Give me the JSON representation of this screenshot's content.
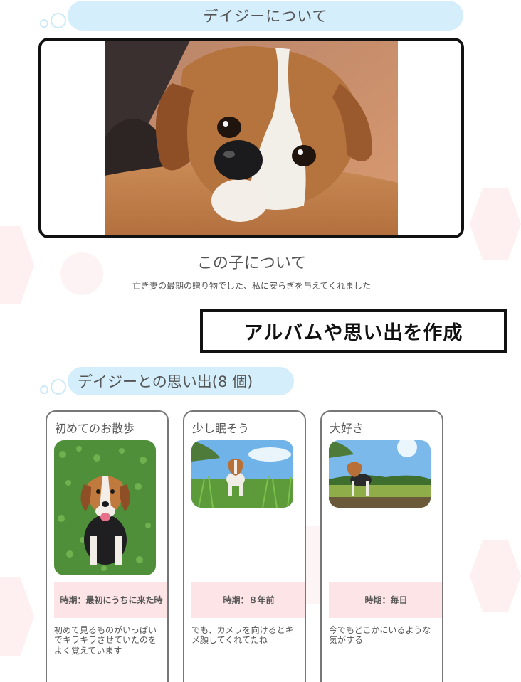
{
  "about_section": {
    "heading": "デイジーについて",
    "subtitle": "この子について",
    "description": "亡き妻の最期の贈り物でした、私に安らぎを与えてくれました"
  },
  "create_button": {
    "label": "アルバムや思い出を作成"
  },
  "memories_section": {
    "heading": "デイジーとの思い出(8 個)"
  },
  "memory_cards": [
    {
      "title": "初めてのお散歩",
      "period": "時期：最初にうちに来た時",
      "description": "初めて見るものがいっぱいでキラキラさせていたのをよく覚えています"
    },
    {
      "title": "少し眠そう",
      "period": "時期：８年前",
      "description": "でも、カメラを向けるとキメ顔してくれてたね"
    },
    {
      "title": "大好き",
      "period": "時期：毎日",
      "description": "今でもどこかにいるような気がする"
    }
  ],
  "colors": {
    "heading_pill": "#d4eefb",
    "period_band": "#fde4e6",
    "frame_border": "#111111",
    "card_border": "#777777"
  }
}
